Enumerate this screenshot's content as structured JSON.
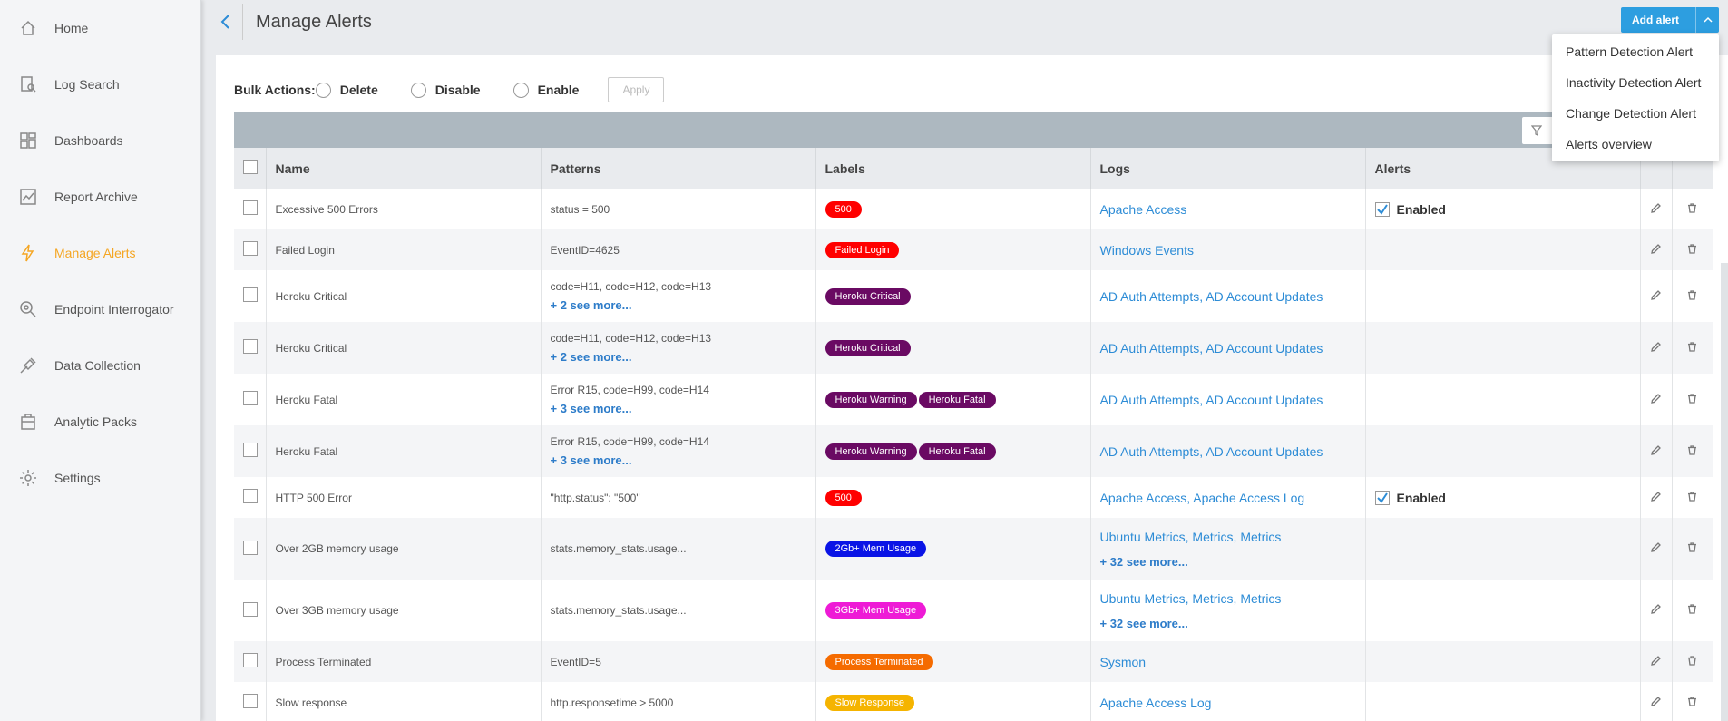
{
  "sidebar": {
    "items": [
      {
        "label": "Home",
        "icon": "home-icon"
      },
      {
        "label": "Log Search",
        "icon": "log-search-icon"
      },
      {
        "label": "Dashboards",
        "icon": "dashboards-icon"
      },
      {
        "label": "Report Archive",
        "icon": "report-archive-icon"
      },
      {
        "label": "Manage Alerts",
        "icon": "bolt-icon",
        "active": true
      },
      {
        "label": "Endpoint Interrogator",
        "icon": "endpoint-search-icon"
      },
      {
        "label": "Data Collection",
        "icon": "plug-icon"
      },
      {
        "label": "Analytic Packs",
        "icon": "package-icon"
      },
      {
        "label": "Settings",
        "icon": "gear-icon"
      }
    ]
  },
  "header": {
    "title": "Manage Alerts",
    "add_alert_label": "Add alert"
  },
  "dropdown": {
    "items": [
      "Pattern Detection Alert",
      "Inactivity Detection Alert",
      "Change Detection Alert",
      "Alerts overview"
    ]
  },
  "bulk": {
    "label": "Bulk Actions:",
    "options": [
      "Delete",
      "Disable",
      "Enable"
    ],
    "apply_label": "Apply"
  },
  "table": {
    "columns": [
      "Name",
      "Patterns",
      "Labels",
      "Logs",
      "Alerts"
    ],
    "rows": [
      {
        "name": "Excessive 500 Errors",
        "patterns": "status = 500",
        "patterns_more": "",
        "labels": [
          {
            "text": "500",
            "color": "#ff0000"
          }
        ],
        "logs": "Apache Access",
        "logs_more": "",
        "alerts": "Enabled"
      },
      {
        "name": "Failed Login",
        "patterns": "EventID=4625",
        "patterns_more": "",
        "labels": [
          {
            "text": "Failed Login",
            "color": "#ff0000"
          }
        ],
        "logs": "Windows Events",
        "logs_more": "",
        "alerts": ""
      },
      {
        "name": "Heroku Critical",
        "patterns": "code=H11, code=H12, code=H13",
        "patterns_more": "+ 2 see more...",
        "labels": [
          {
            "text": "Heroku Critical",
            "color": "#6a0a63"
          }
        ],
        "logs": "AD Auth Attempts, AD Account Updates",
        "logs_more": "",
        "alerts": ""
      },
      {
        "name": "Heroku Critical",
        "patterns": "code=H11, code=H12, code=H13",
        "patterns_more": "+ 2 see more...",
        "labels": [
          {
            "text": "Heroku Critical",
            "color": "#6a0a63"
          }
        ],
        "logs": "AD Auth Attempts, AD Account Updates",
        "logs_more": "",
        "alerts": ""
      },
      {
        "name": "Heroku Fatal",
        "patterns": "Error R15, code=H99, code=H14",
        "patterns_more": "+ 3 see more...",
        "labels": [
          {
            "text": "Heroku Warning",
            "color": "#6a0a63"
          },
          {
            "text": "Heroku Fatal",
            "color": "#6a0a63"
          }
        ],
        "logs": "AD Auth Attempts, AD Account Updates",
        "logs_more": "",
        "alerts": ""
      },
      {
        "name": "Heroku Fatal",
        "patterns": "Error R15, code=H99, code=H14",
        "patterns_more": "+ 3 see more...",
        "labels": [
          {
            "text": "Heroku Warning",
            "color": "#6a0a63"
          },
          {
            "text": "Heroku Fatal",
            "color": "#6a0a63"
          }
        ],
        "logs": "AD Auth Attempts, AD Account Updates",
        "logs_more": "",
        "alerts": ""
      },
      {
        "name": "HTTP 500 Error",
        "patterns": "\"http.status\": \"500\"",
        "patterns_more": "",
        "labels": [
          {
            "text": "500",
            "color": "#ff0000"
          }
        ],
        "logs": "Apache Access, Apache Access Log",
        "logs_more": "",
        "alerts": "Enabled"
      },
      {
        "name": "Over 2GB memory usage",
        "patterns": "stats.memory_stats.usage...",
        "patterns_more": "",
        "labels": [
          {
            "text": "2Gb+ Mem Usage",
            "color": "#0a14e6"
          }
        ],
        "logs": "Ubuntu Metrics, Metrics, Metrics",
        "logs_more": "+ 32 see more...",
        "alerts": ""
      },
      {
        "name": "Over 3GB memory usage",
        "patterns": "stats.memory_stats.usage...",
        "patterns_more": "",
        "labels": [
          {
            "text": "3Gb+ Mem Usage",
            "color": "#ee1bd6"
          }
        ],
        "logs": "Ubuntu Metrics, Metrics, Metrics",
        "logs_more": "+ 32 see more...",
        "alerts": ""
      },
      {
        "name": "Process Terminated",
        "patterns": "EventID=5",
        "patterns_more": "",
        "labels": [
          {
            "text": "Process Terminated",
            "color": "#f56b00"
          }
        ],
        "logs": "Sysmon",
        "logs_more": "",
        "alerts": ""
      },
      {
        "name": "Slow response",
        "patterns": "http.responsetime > 5000",
        "patterns_more": "",
        "labels": [
          {
            "text": "Slow Response",
            "color": "#f5b400"
          }
        ],
        "logs": "Apache Access Log",
        "logs_more": "",
        "alerts": ""
      }
    ]
  }
}
